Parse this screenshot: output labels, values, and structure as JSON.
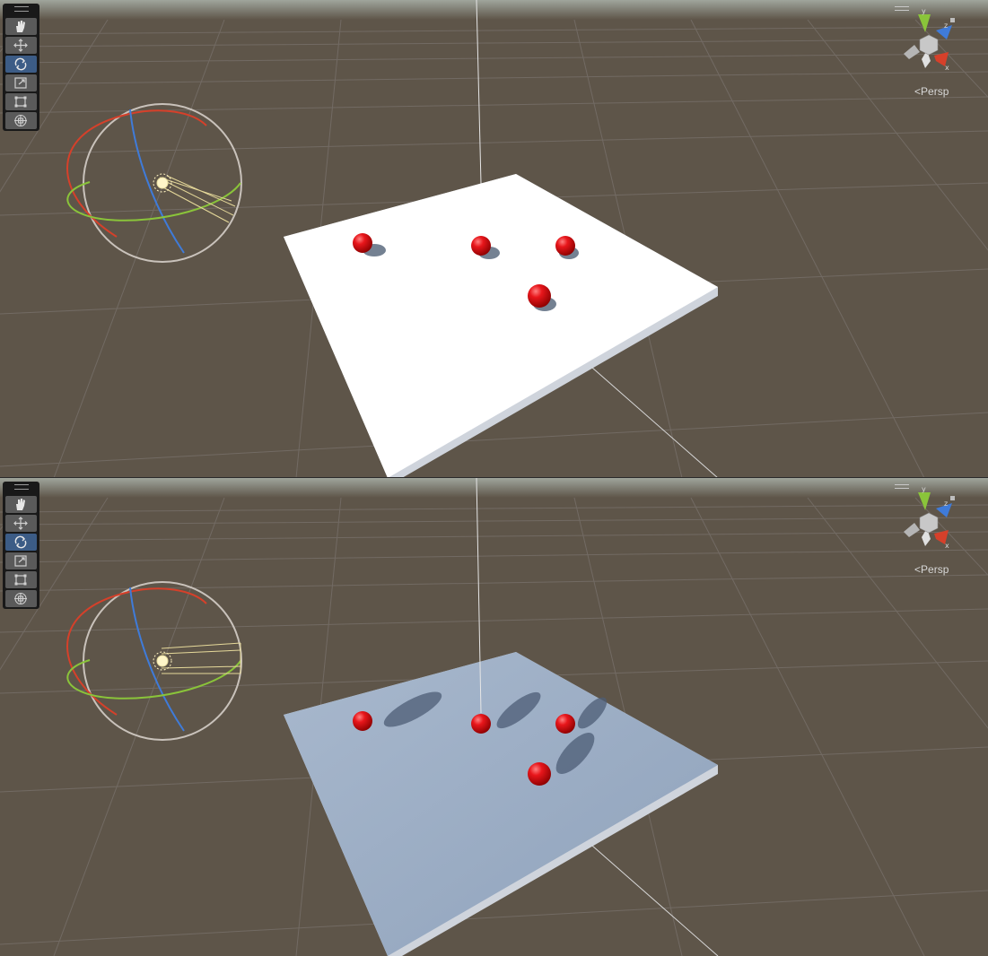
{
  "views": [
    {
      "id": "scene-view-top",
      "projection_label": "Persp",
      "toolbar": {
        "tools": [
          {
            "name": "hand-tool",
            "icon": "hand-icon",
            "active": false
          },
          {
            "name": "move-tool",
            "icon": "move-arrows-icon",
            "active": false
          },
          {
            "name": "rotate-tool",
            "icon": "rotate-icon",
            "active": true
          },
          {
            "name": "scale-tool",
            "icon": "scale-icon",
            "active": false
          },
          {
            "name": "rect-tool",
            "icon": "rect-icon",
            "active": false
          },
          {
            "name": "transform-tool",
            "icon": "transform-icon",
            "active": false
          }
        ]
      },
      "axis_gizmo": {
        "x": "x",
        "y": "y",
        "z": "z"
      },
      "plane_color": "#ffffff",
      "shadow_style": "short"
    },
    {
      "id": "scene-view-bottom",
      "projection_label": "Persp",
      "toolbar": {
        "tools": [
          {
            "name": "hand-tool",
            "icon": "hand-icon",
            "active": false
          },
          {
            "name": "move-tool",
            "icon": "move-arrows-icon",
            "active": false
          },
          {
            "name": "rotate-tool",
            "icon": "rotate-icon",
            "active": true
          },
          {
            "name": "scale-tool",
            "icon": "scale-icon",
            "active": false
          },
          {
            "name": "rect-tool",
            "icon": "rect-icon",
            "active": false
          },
          {
            "name": "transform-tool",
            "icon": "transform-icon",
            "active": false
          }
        ]
      },
      "axis_gizmo": {
        "x": "x",
        "y": "y",
        "z": "z"
      },
      "plane_color": "#9dafc6",
      "shadow_style": "long"
    }
  ],
  "colors": {
    "ground": "#5e5549",
    "sphere": "#e0141a",
    "active_tool": "#3c5c86",
    "axis_x": "#d6402a",
    "axis_y": "#8ac43a",
    "axis_z": "#3f7bd9"
  }
}
